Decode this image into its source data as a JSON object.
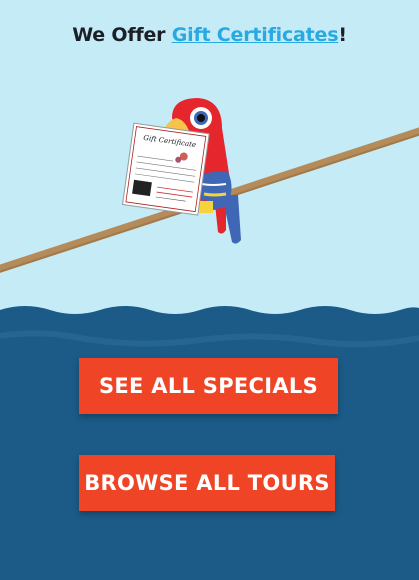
{
  "headline": {
    "prefix": "We Offer ",
    "link_text": "Gift Certificates",
    "suffix": "!"
  },
  "certificate": {
    "title": "Gift Certificate"
  },
  "buttons": {
    "specials_label": "SEE ALL SPECIALS",
    "tours_label": "BROWSE ALL TOURS"
  },
  "colors": {
    "sky": "#c4ebf6",
    "sea": "#1c5b87",
    "button": "#ef4526",
    "link": "#29a9e1",
    "parrot_red": "#e5262d",
    "parrot_blue": "#3f67b5"
  }
}
